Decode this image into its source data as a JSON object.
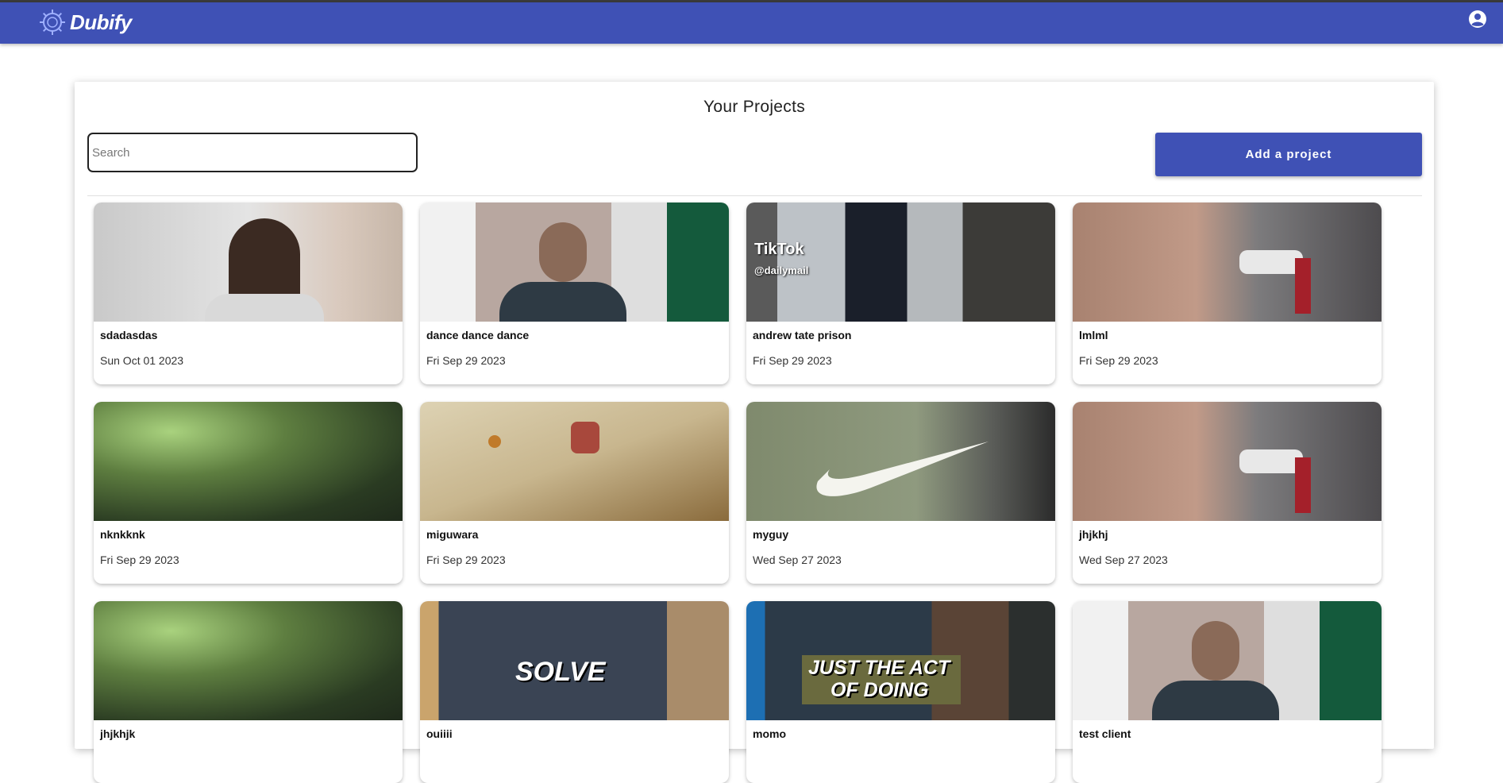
{
  "appbar": {
    "brand": "Dubify",
    "account_icon": "account-circle-icon",
    "logo_icon": "gear-logo-icon"
  },
  "main": {
    "title": "Your Projects",
    "search_placeholder": "Search",
    "search_value": "",
    "add_button_label": "Add a project"
  },
  "projects": [
    {
      "name": "sdadasdas",
      "date": "Sun Oct 01 2023"
    },
    {
      "name": "dance dance dance",
      "date": "Fri Sep 29 2023"
    },
    {
      "name": "andrew tate prison",
      "date": "Fri Sep 29 2023",
      "thumb_text": {
        "brand": "TikTok",
        "handle": "@dailymail"
      }
    },
    {
      "name": "lmlml",
      "date": "Fri Sep 29 2023"
    },
    {
      "name": "nknkknk",
      "date": "Fri Sep 29 2023"
    },
    {
      "name": "miguwara",
      "date": "Fri Sep 29 2023"
    },
    {
      "name": "myguy",
      "date": "Wed Sep 27 2023"
    },
    {
      "name": "jhjkhj",
      "date": "Wed Sep 27 2023"
    },
    {
      "name": "jhjkhjk",
      "date": ""
    },
    {
      "name": "ouiiii",
      "date": "",
      "thumb_text": {
        "caption": "SOLVE"
      }
    },
    {
      "name": "momo",
      "date": "",
      "thumb_text": {
        "caption_line1": "JUST THE ACT",
        "caption_line2": "OF DOING"
      }
    },
    {
      "name": "test client",
      "date": ""
    }
  ],
  "colors": {
    "primary": "#3f51b5",
    "background": "#ffffff"
  }
}
